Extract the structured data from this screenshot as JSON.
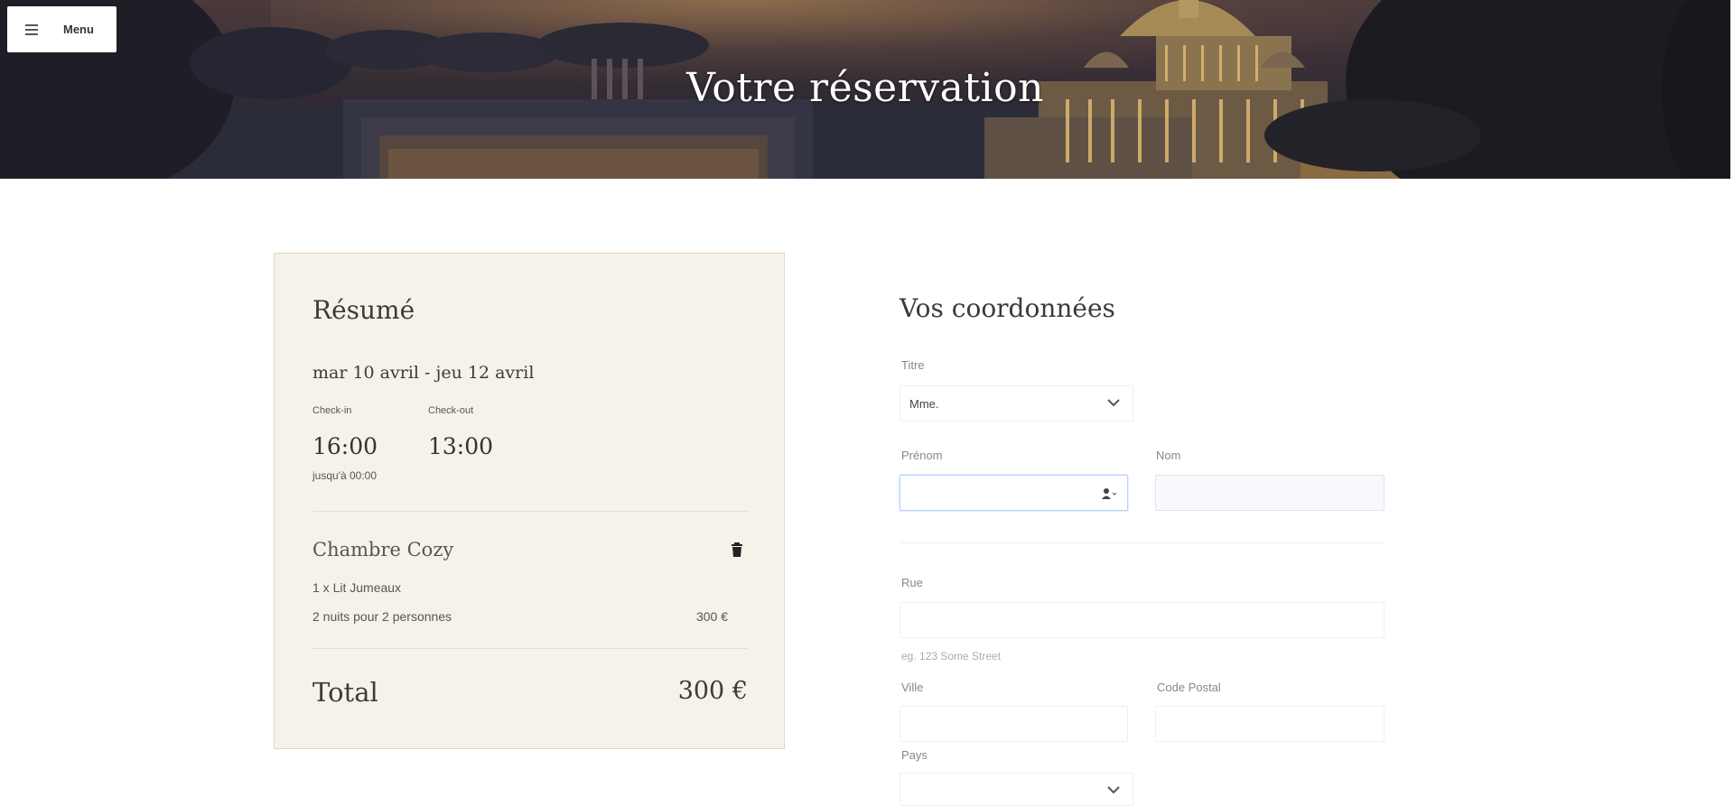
{
  "nav": {
    "menu_label": "Menu"
  },
  "hero": {
    "title": "Votre réservation"
  },
  "summary": {
    "heading": "Résumé",
    "dates": "mar 10 avril - jeu 12 avril",
    "checkin_label": "Check-in",
    "checkin_time": "16:00",
    "checkin_until": "jusqu'à 00:00",
    "checkout_label": "Check-out",
    "checkout_time": "13:00",
    "room_name": "Chambre Cozy",
    "bed": "1 x Lit Jumeaux",
    "stay": "2 nuits pour 2 personnes",
    "stay_price": "300 €",
    "total_label": "Total",
    "total_value": "300 €"
  },
  "form": {
    "heading": "Vos coordonnées",
    "title_label": "Titre",
    "title_value": "Mme.",
    "firstname_label": "Prénom",
    "lastname_label": "Nom",
    "street_label": "Rue",
    "street_hint": "eg. 123 Some Street",
    "city_label": "Ville",
    "zip_label": "Code Postal",
    "country_label": "Pays",
    "country_value": ""
  }
}
